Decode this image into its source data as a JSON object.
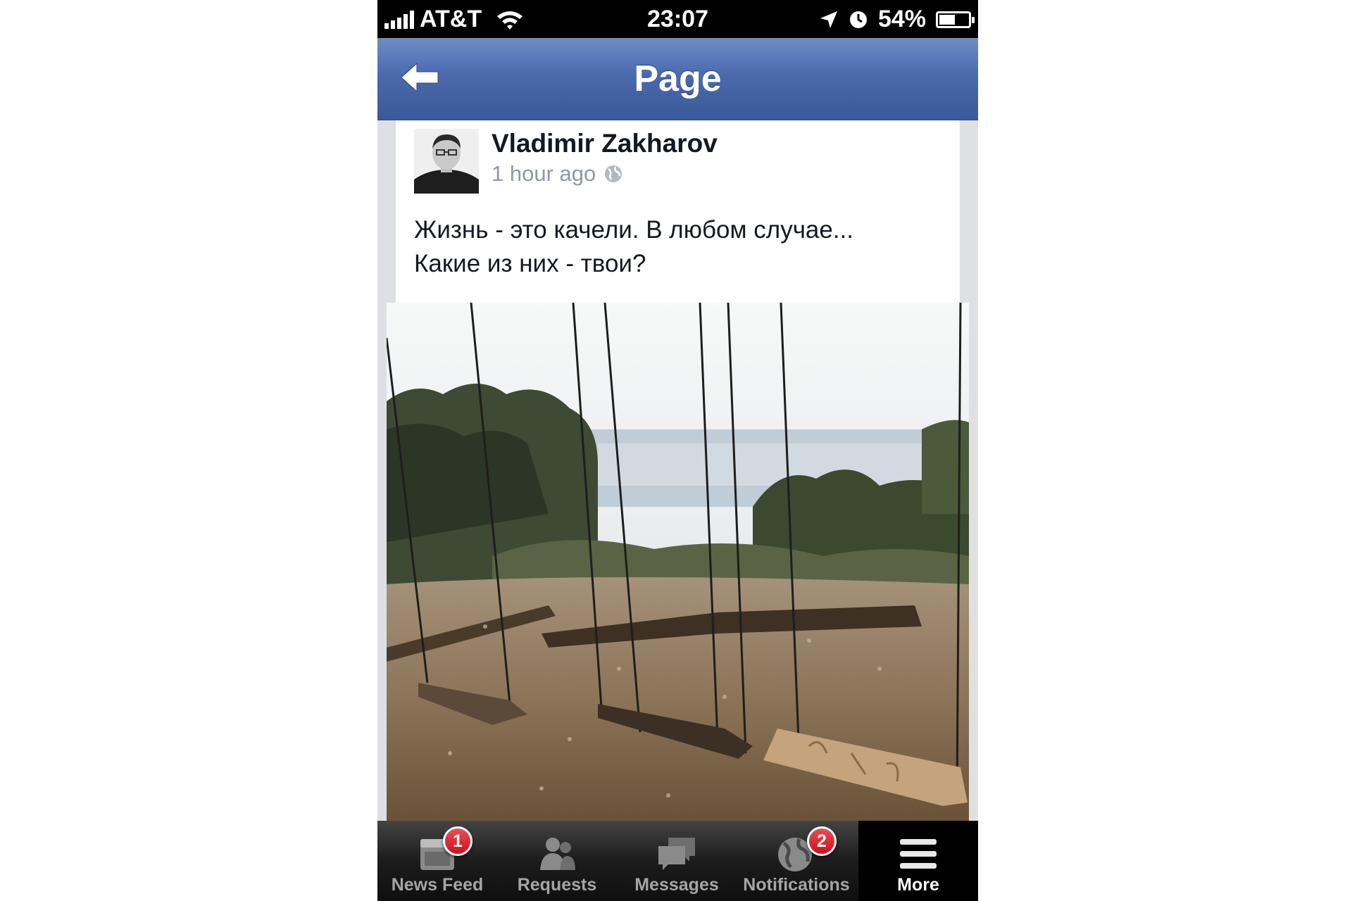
{
  "status_bar": {
    "carrier": "AT&T",
    "time": "23:07",
    "battery_percent": "54%",
    "battery_level": 0.54
  },
  "nav": {
    "title": "Page"
  },
  "post": {
    "author": "Vladimir Zakharov",
    "timestamp": "1 hour ago",
    "text_line1": "Жизнь - это качели. В любом случае...",
    "text_line2": "Какие из них - твои?"
  },
  "tabs": [
    {
      "label": "News Feed",
      "icon": "news-feed-icon",
      "badge": "1"
    },
    {
      "label": "Requests",
      "icon": "requests-icon",
      "badge": ""
    },
    {
      "label": "Messages",
      "icon": "messages-icon",
      "badge": ""
    },
    {
      "label": "Notifications",
      "icon": "globe-icon",
      "badge": "2"
    },
    {
      "label": "More",
      "icon": "menu-icon",
      "badge": "",
      "active": true
    }
  ],
  "colors": {
    "nav_blue": "#3b5998",
    "badge_red": "#d8222c"
  }
}
